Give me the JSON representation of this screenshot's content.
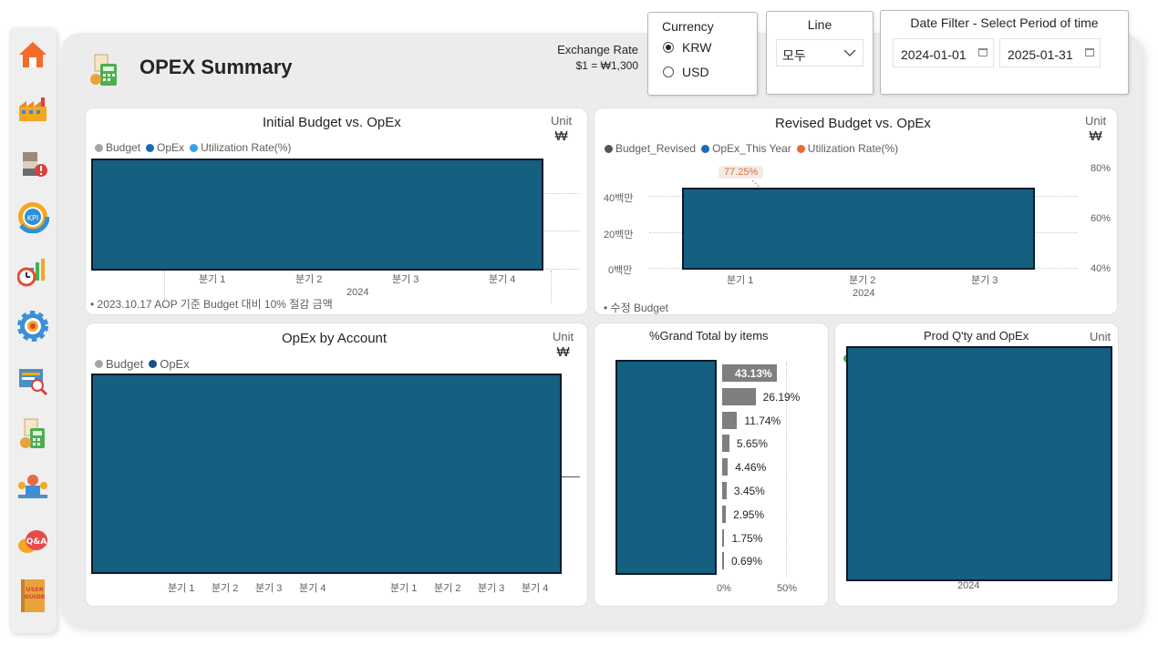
{
  "nav": {
    "items": [
      {
        "icon": "home-icon",
        "color": "#f26b2a"
      },
      {
        "icon": "factory-icon",
        "color": "#f5a623"
      },
      {
        "icon": "materials-alert-icon",
        "color": "#d9413a"
      },
      {
        "icon": "kpi-gauge-icon",
        "color": "#2f8fd8"
      },
      {
        "icon": "bar-chart-clock-icon",
        "color": "#e8492f"
      },
      {
        "icon": "settings-gear-icon",
        "color": "#3b8fd6"
      },
      {
        "icon": "search-report-icon",
        "color": "#4a90c2"
      },
      {
        "icon": "opex-calculator-icon",
        "color": "#4caf50"
      },
      {
        "icon": "team-meeting-icon",
        "color": "#e56a4a"
      },
      {
        "icon": "qa-chat-icon",
        "color": "#e84a4a"
      },
      {
        "icon": "user-guide-book-icon",
        "color": "#e8a43a"
      }
    ],
    "qa_label": "Q&A",
    "kpi_label": "KPI",
    "guide_label": "USER GUIDE"
  },
  "header": {
    "title": "OPEX Summary",
    "exchange_rate_label": "Exchange Rate",
    "exchange_rate_value": "$1 = ₩1,300"
  },
  "filters": {
    "currency": {
      "title": "Currency",
      "options": [
        "KRW",
        "USD"
      ],
      "selected": "KRW"
    },
    "line": {
      "title": "Line",
      "selected": "모두"
    },
    "date": {
      "title": "Date Filter - Select Period of time",
      "start": "2024-01-01",
      "end": "2025-01-31"
    }
  },
  "cards": {
    "initial": {
      "title": "Initial Budget vs. OpEx",
      "unit_label": "Unit",
      "unit_symbol": "₩",
      "legend": [
        {
          "name": "Budget",
          "color": "#a6a6a6"
        },
        {
          "name": "OpEx",
          "color": "#1b6bb5"
        },
        {
          "name": "Utilization Rate(%)",
          "color": "#3aa0e8"
        }
      ],
      "x_ticks": [
        "분기 1",
        "분기 2",
        "분기 3",
        "분기 4"
      ],
      "x_year": "2024",
      "footnote": "• 2023.10.17 AOP 기준 Budget 대비 10% 절감 금액"
    },
    "revised": {
      "title": "Revised Budget vs. OpEx",
      "unit_label": "Unit",
      "unit_symbol": "₩",
      "legend": [
        {
          "name": "Budget_Revised",
          "color": "#555555"
        },
        {
          "name": "OpEx_This Year",
          "color": "#1b6bb5"
        },
        {
          "name": "Utilization Rate(%)",
          "color": "#e66c37"
        }
      ],
      "y_left_ticks": [
        "40백만",
        "20백만",
        "0백만"
      ],
      "y_right_ticks": [
        "80%",
        "60%",
        "40%"
      ],
      "x_ticks": [
        "분기 1",
        "분기 2",
        "분기 3"
      ],
      "x_year": "2024",
      "data_label": "77.25%",
      "footnote": "• 수정 Budget"
    },
    "account": {
      "title": "OpEx by Account",
      "unit_label": "Unit",
      "unit_symbol": "₩",
      "legend": [
        {
          "name": "Budget",
          "color": "#a6a6a6"
        },
        {
          "name": "OpEx",
          "color": "#1b4f8a"
        }
      ],
      "x_ticks_left": [
        "분기 1",
        "분기 2",
        "분기 3",
        "분기 4"
      ],
      "x_ticks_right": [
        "분기 1",
        "분기 2",
        "분기 3",
        "분기 4"
      ]
    },
    "grand_total": {
      "title": "%Grand Total by items",
      "x_ticks": [
        "0%",
        "50%"
      ]
    },
    "prod": {
      "title": "Prod Q'ty and OpEx",
      "unit_label": "Unit",
      "x_year": "2024"
    }
  },
  "chart_data": {
    "type": "bar",
    "title": "%Grand Total by items",
    "values": [
      43.13,
      26.19,
      11.74,
      5.65,
      4.46,
      3.45,
      2.95,
      1.75,
      0.69
    ],
    "labels": [
      "43.13%",
      "26.19%",
      "11.74%",
      "5.65%",
      "4.46%",
      "3.45%",
      "2.95%",
      "1.75%",
      "0.69%"
    ],
    "xlim": [
      0,
      50
    ],
    "orientation": "horizontal"
  }
}
